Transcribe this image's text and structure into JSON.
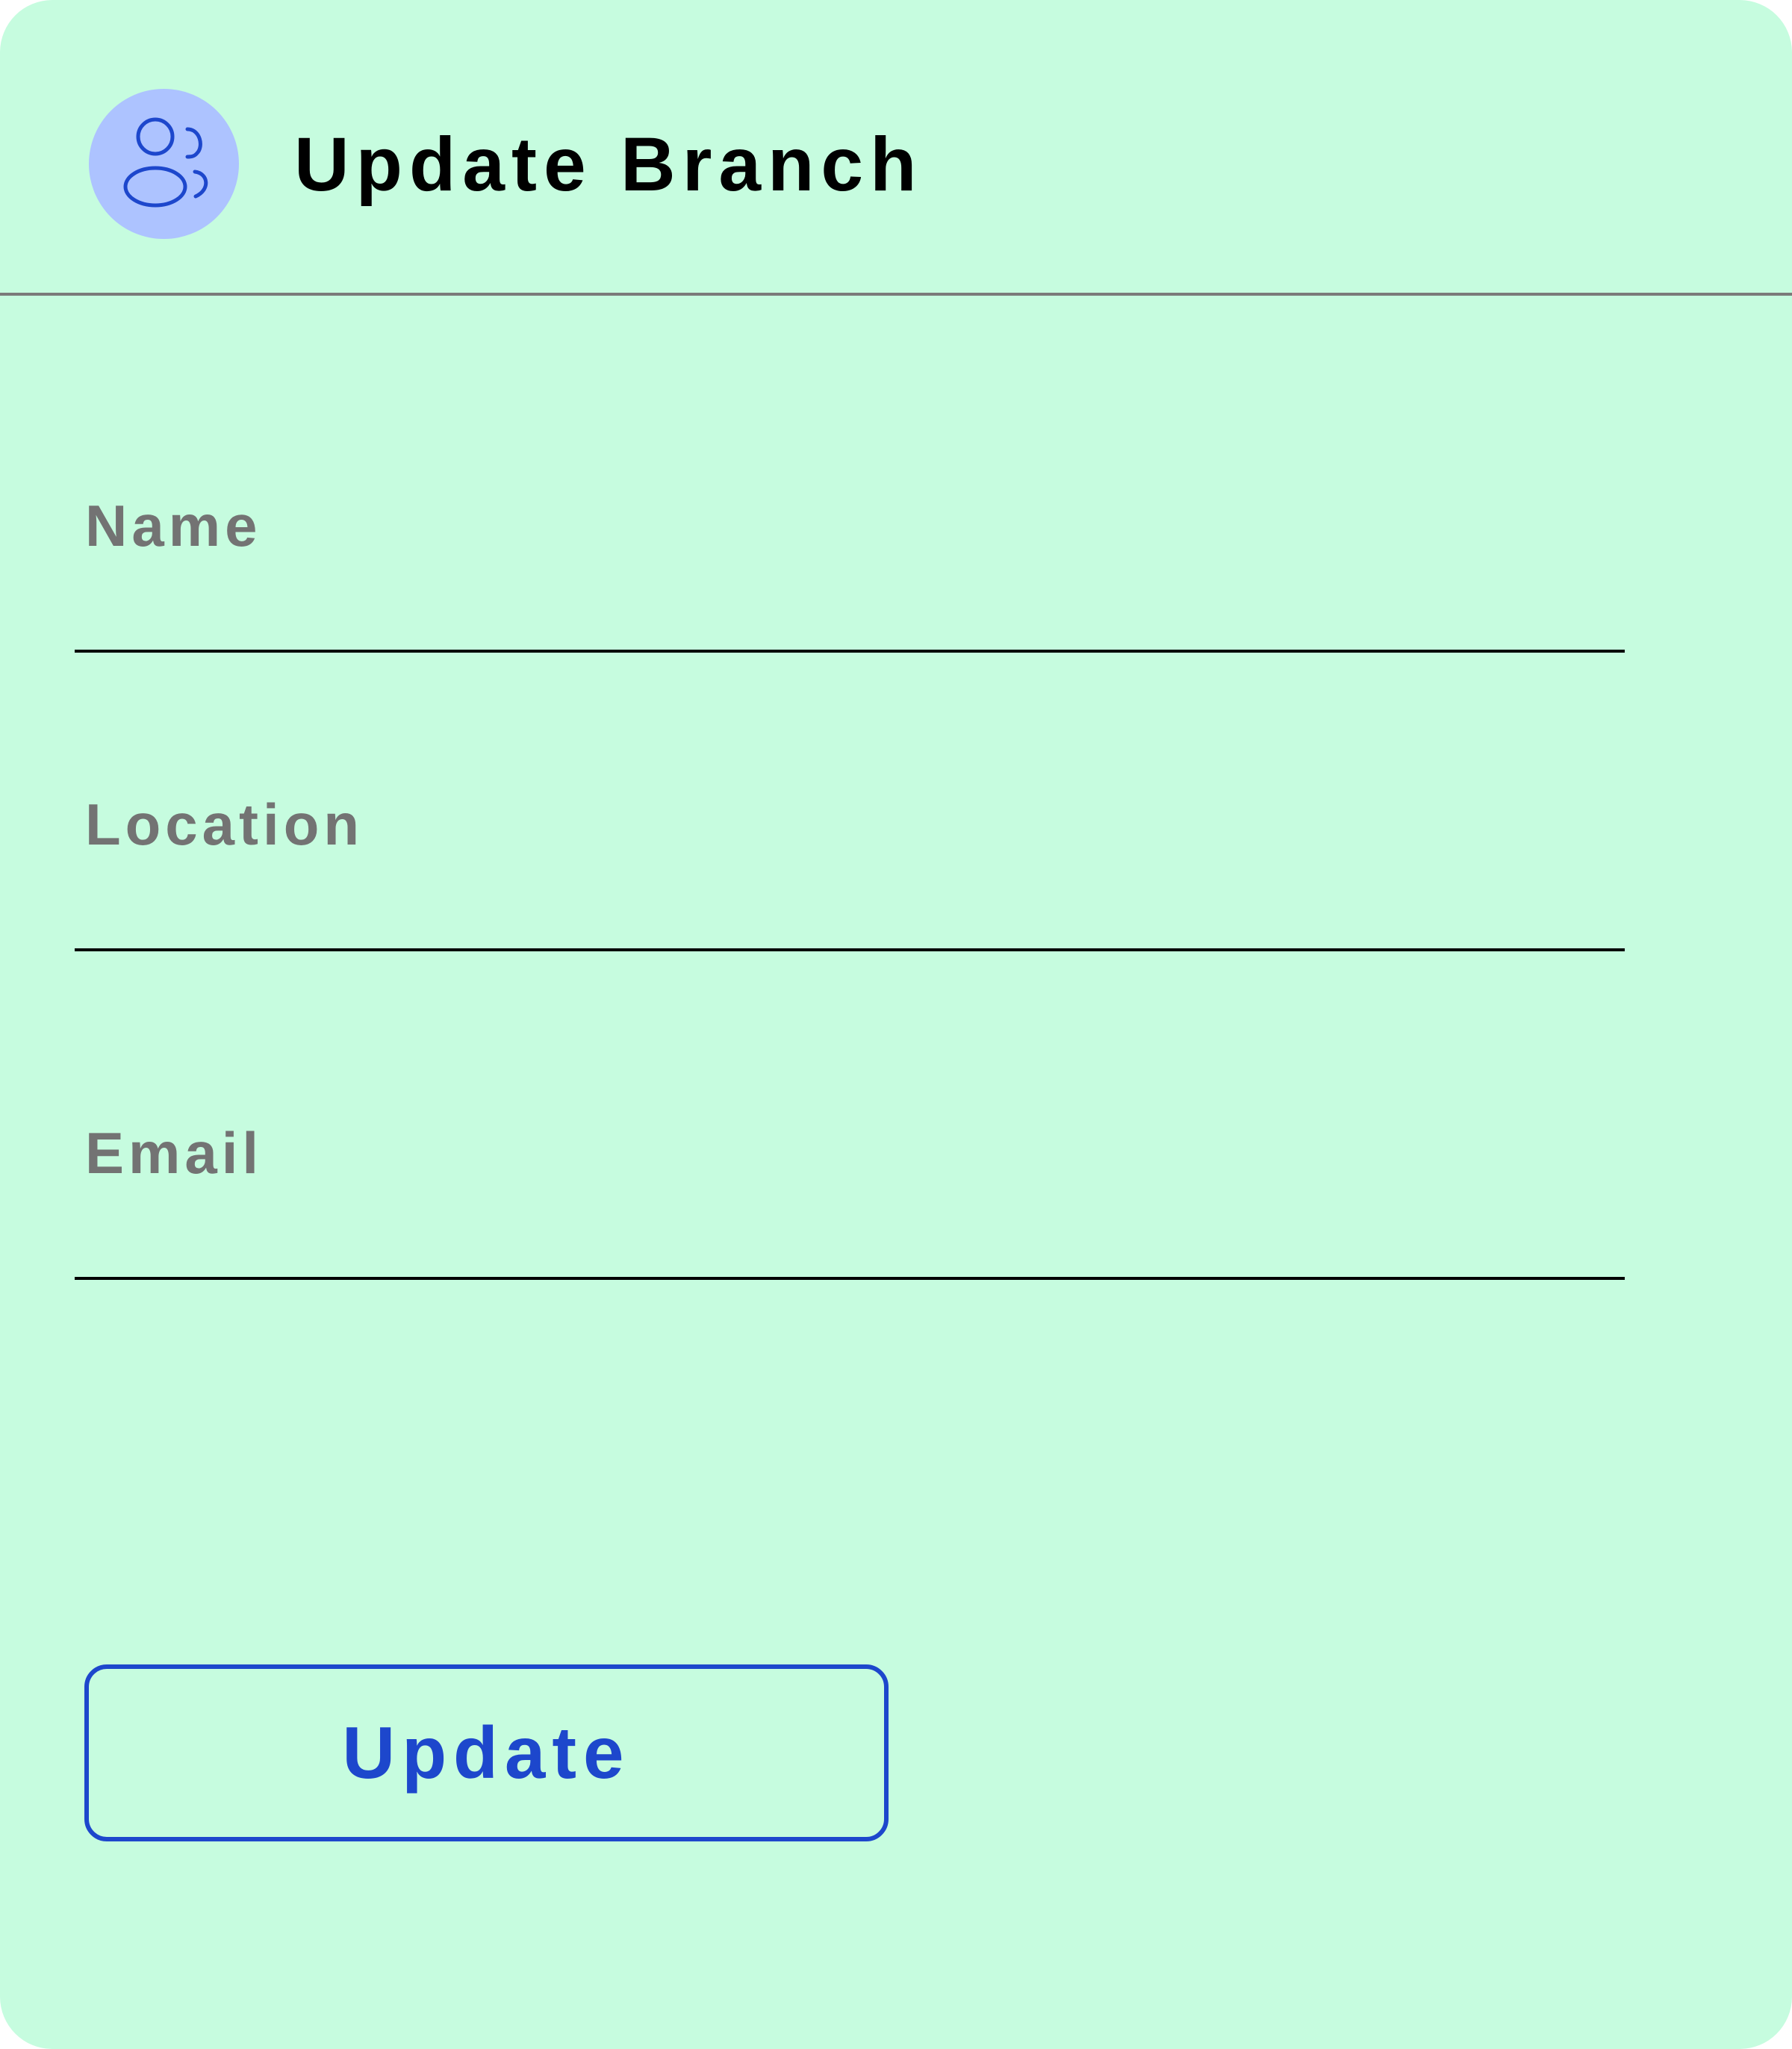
{
  "dialog": {
    "title": "Update Branch",
    "icon": "users-icon"
  },
  "form": {
    "fields": [
      {
        "label": "Name",
        "value": "",
        "placeholder": ""
      },
      {
        "label": "Location",
        "value": "",
        "placeholder": ""
      },
      {
        "label": "Email",
        "value": "",
        "placeholder": ""
      }
    ],
    "submit_label": "Update"
  },
  "colors": {
    "background": "#c6fcdf",
    "avatar_background": "#adc3ff",
    "accent": "#1d47cc",
    "label_text": "#737373",
    "title_text": "#000000",
    "divider": "#7a7a7a"
  }
}
